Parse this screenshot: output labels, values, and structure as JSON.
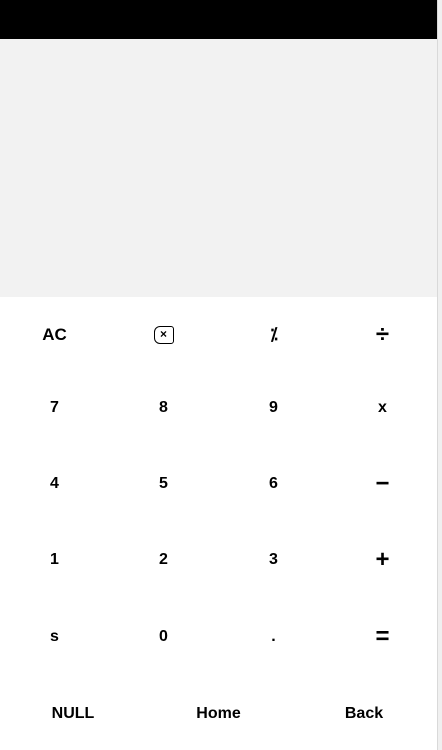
{
  "display": {
    "expression": "",
    "result": ""
  },
  "keypad": {
    "row1": {
      "clear": "AC",
      "backspace_glyph": "×",
      "percent": "⁒",
      "divide": "÷"
    },
    "row2": {
      "k7": "7",
      "k8": "8",
      "k9": "9",
      "multiply": "x"
    },
    "row3": {
      "k4": "4",
      "k5": "5",
      "k6": "6",
      "minus": "−"
    },
    "row4": {
      "k1": "1",
      "k2": "2",
      "k3": "3",
      "plus": "+"
    },
    "row5": {
      "s": "s",
      "k0": "0",
      "dot": ".",
      "equals": "="
    }
  },
  "nav": {
    "null_label": "NULL",
    "home_label": "Home",
    "back_label": "Back"
  },
  "icons": {
    "backspace": "backspace-icon",
    "percent": "percent-icon"
  },
  "colors": {
    "status_bar": "#000000",
    "display_bg": "#f2f2f2",
    "keypad_bg": "#ffffff",
    "text": "#000000"
  }
}
